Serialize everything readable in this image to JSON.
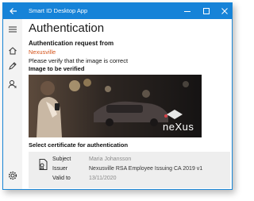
{
  "window": {
    "title": "Smart ID Desktop App"
  },
  "page": {
    "title": "Authentication",
    "request_label": "Authentication request from",
    "requester": "Nexusville",
    "verify_text": "Please verify that the image is correct",
    "image_label": "Image to be verified",
    "image_brand": "neXus"
  },
  "certificate": {
    "section_label": "Select certificate for authentication",
    "subject_label": "Subject",
    "subject_value": "Maria Johansson",
    "issuer_label": "Issuer",
    "issuer_value": "Nexusville RSA Employee Issuing CA 2019 v1",
    "valid_label": "Valid to",
    "valid_value": "13/11/2020"
  },
  "sidebar": {
    "items": [
      {
        "icon": "hamburger-menu-icon"
      },
      {
        "icon": "home-icon"
      },
      {
        "icon": "pencil-icon"
      },
      {
        "icon": "user-icon"
      },
      {
        "icon": "settings-gear-icon"
      }
    ]
  },
  "colors": {
    "titlebar": "#1683d8",
    "accent": "#1a86d6",
    "requester": "#d4541b",
    "card_bg": "#eeeeee"
  }
}
